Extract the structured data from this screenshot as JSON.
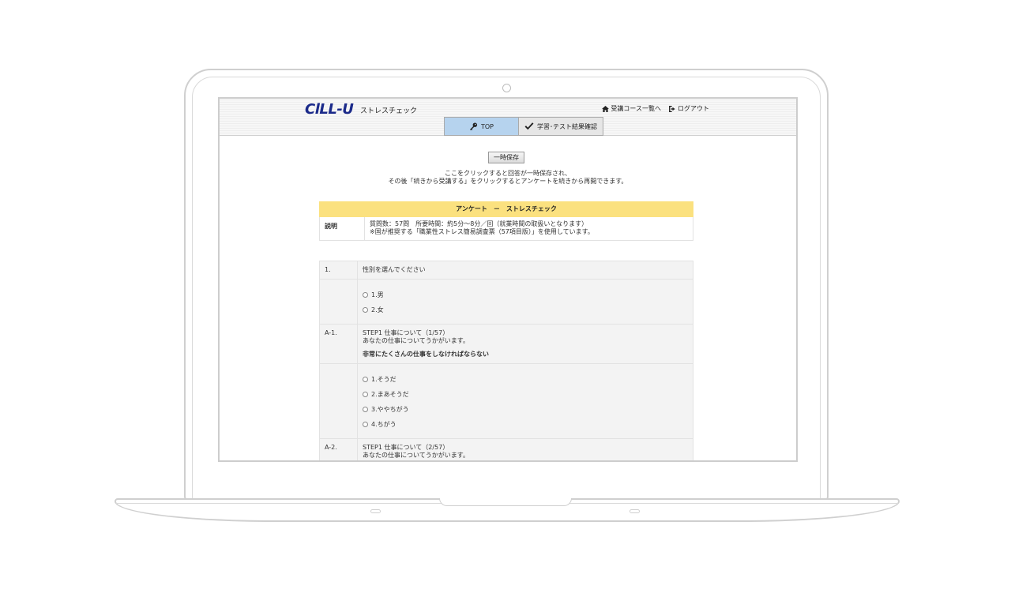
{
  "header": {
    "logo": "ClLL-U",
    "app_title": "ストレスチェック",
    "course_list_link": "受講コース一覧へ",
    "logout_link": "ログアウト"
  },
  "tabs": [
    {
      "label": "TOP"
    },
    {
      "label": "学習･テスト結果確認"
    }
  ],
  "save": {
    "button_label": "一時保存",
    "note_line1": "ここをクリックすると回答が一時保存され、",
    "note_line2": "その後「続きから受講する」をクリックするとアンケートを続きから再開できます。"
  },
  "survey": {
    "title": "アンケート　－　ストレスチェック",
    "desc_label": "説明",
    "desc_line1": "質問数：57問　所要時間：約5分～8分／回（就業時間の取扱いとなります）",
    "desc_line2": "※国が推奨する「職業性ストレス簡易調査票（57項目版）」を使用しています。"
  },
  "questions": [
    {
      "num": "1.",
      "text": "性別を選んでください",
      "options": [
        "1.男",
        "2.女"
      ]
    },
    {
      "num": "A-1.",
      "step": "STEP1 仕事について（1/57）",
      "intro": "あなたの仕事についてうかがいます。",
      "text": "非常にたくさんの仕事をしなければならない",
      "options": [
        "1.そうだ",
        "2.まあそうだ",
        "3.ややちがう",
        "4.ちがう"
      ]
    },
    {
      "num": "A-2.",
      "step": "STEP1 仕事について（2/57）",
      "intro": "あなたの仕事についてうかがいます。"
    }
  ],
  "colors": {
    "survey_header_bg": "#fbe17f",
    "active_tab_bg": "#b6d3ee",
    "logo": "#1b2a8a"
  }
}
